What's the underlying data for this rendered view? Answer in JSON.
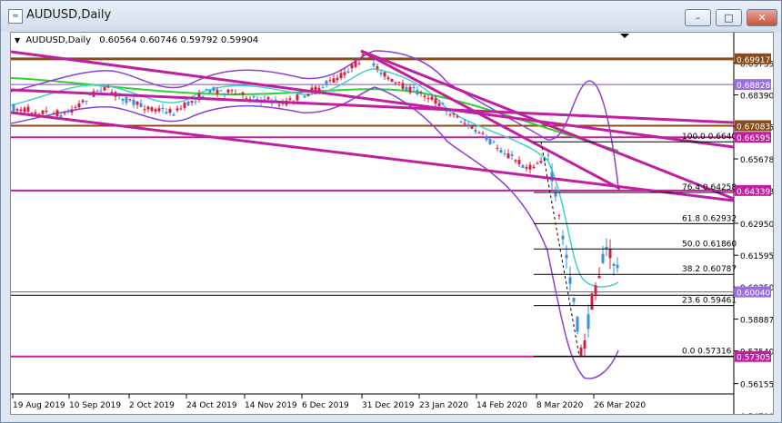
{
  "window": {
    "title": "AUDUSD,Daily",
    "buttons": {
      "minimize": "–",
      "maximize": "□",
      "close": "✕"
    }
  },
  "infobar": {
    "symbol": "AUDUSD,Daily",
    "ohlc": "0.60564 0.60746 0.59792 0.59904"
  },
  "colors": {
    "up_candle": "#d02040",
    "down_candle": "#3a8ee6",
    "magenta": "#c020a0",
    "brown": "#8b4a1a",
    "violet": "#8a40d8",
    "green": "#30d030",
    "cyan": "#40d0c8"
  },
  "price_axis": {
    "ticks": [
      "0.69735",
      "0.68390",
      "0.67045",
      "0.65678",
      "0.64333",
      "0.62950",
      "0.61595",
      "0.60250",
      "0.58887",
      "0.57540",
      "0.56155",
      "0.54790"
    ],
    "tags": [
      {
        "text": "0.69917",
        "color": "#8b4a1a"
      },
      {
        "text": "0.68828",
        "color": "#9a70e0"
      },
      {
        "text": "0.67083",
        "color": "#8b4a1a"
      },
      {
        "text": "0.66595",
        "color": "#c020a0"
      },
      {
        "text": "0.64339",
        "color": "#c020a0"
      },
      {
        "text": "0.60040",
        "color": "#9a70e0"
      },
      {
        "text": "0.57305",
        "color": "#c020a0"
      }
    ]
  },
  "fibonacci": [
    {
      "label": "100.0 0.66402"
    },
    {
      "label": "76.4 0.64258"
    },
    {
      "label": "61.8 0.62932"
    },
    {
      "label": "50.0 0.61860"
    },
    {
      "label": "38.2 0.60787"
    },
    {
      "label": "23.6 0.59461"
    },
    {
      "label": "0.0 0.57316"
    }
  ],
  "time_axis": [
    "19 Aug 2019",
    "10 Sep 2019",
    "2 Oct 2019",
    "24 Oct 2019",
    "14 Nov 2019",
    "6 Dec 2019",
    "31 Dec 2019",
    "23 Jan 2020",
    "14 Feb 2020",
    "8 Mar 2020",
    "26 Mar 2020"
  ]
}
